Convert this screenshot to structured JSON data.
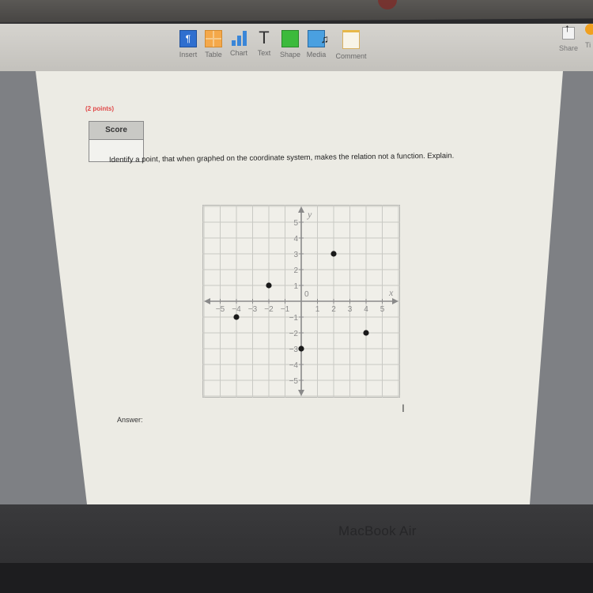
{
  "toolbar": {
    "items": [
      {
        "label": "Insert",
        "icon": "insert-icon"
      },
      {
        "label": "Table",
        "icon": "table-icon"
      },
      {
        "label": "Chart",
        "icon": "chart-icon"
      },
      {
        "label": "Text",
        "icon": "text-icon"
      },
      {
        "label": "Shape",
        "icon": "shape-icon"
      },
      {
        "label": "Media",
        "icon": "media-icon"
      },
      {
        "label": "Comment",
        "icon": "comment-icon"
      }
    ],
    "text_glyph": "T",
    "insert_glyph": "¶",
    "share_label": "Share",
    "tips_label": "Ti"
  },
  "question": {
    "points": "(2 points)",
    "score_label": "Score",
    "prompt": "Identify a point, that when graphed on the coordinate system, makes the relation not a function. Explain.",
    "answer_label": "Answer:"
  },
  "laptop": {
    "brand": "MacBook Air"
  },
  "chart_data": {
    "type": "scatter",
    "title": "",
    "xlabel": "x",
    "ylabel": "y",
    "origin_label": "0",
    "xlim": [
      -6,
      6
    ],
    "ylim": [
      -6,
      6
    ],
    "grid": true,
    "x_ticks": [
      -5,
      -4,
      -3,
      -2,
      -1,
      1,
      2,
      3,
      4,
      5
    ],
    "y_ticks": [
      -5,
      -4,
      -3,
      -2,
      -1,
      1,
      2,
      3,
      4,
      5
    ],
    "points": [
      {
        "x": -2,
        "y": 1
      },
      {
        "x": 2,
        "y": 3
      },
      {
        "x": -4,
        "y": -1
      },
      {
        "x": 0,
        "y": -3
      },
      {
        "x": 4,
        "y": -2
      }
    ]
  }
}
